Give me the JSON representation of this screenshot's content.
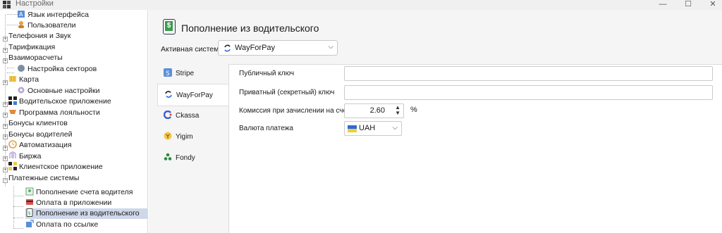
{
  "window": {
    "title": "Настройки"
  },
  "tree": {
    "items": [
      {
        "label": "Язык интерфейса"
      },
      {
        "label": "Пользователи"
      },
      {
        "label": "Телефония и Звук"
      },
      {
        "label": "Тарификация"
      },
      {
        "label": "Взаиморасчеты"
      },
      {
        "label": "Настройка секторов"
      },
      {
        "label": "Карта"
      },
      {
        "label": "Основные настройки"
      },
      {
        "label": "Водительское приложение"
      },
      {
        "label": "Программа лояльности"
      },
      {
        "label": "Бонусы клиентов"
      },
      {
        "label": "Бонусы водителей"
      },
      {
        "label": "Автоматизация"
      },
      {
        "label": "Биржа"
      },
      {
        "label": "Клиентское приложение"
      },
      {
        "label": "Платежные системы"
      },
      {
        "label": "Пополнение счета водителя"
      },
      {
        "label": "Оплата в приложении"
      },
      {
        "label": "Пополнение из водительского"
      },
      {
        "label": "Оплата по ссылке"
      }
    ]
  },
  "header": {
    "title": "Пополнение из водительского",
    "icon": "dollar-phone-icon",
    "icon_glyph": "$"
  },
  "active_system": {
    "label": "Активная система:",
    "value": "WayForPay"
  },
  "tabs": [
    {
      "label": "Stripe"
    },
    {
      "label": "WayForPay"
    },
    {
      "label": "Ckassa"
    },
    {
      "label": "Yigim"
    },
    {
      "label": "Fondy"
    }
  ],
  "form": {
    "public_key": {
      "label": "Публичный ключ",
      "value": ""
    },
    "private_key": {
      "label": "Приватный (секретный) ключ",
      "value": ""
    },
    "commission": {
      "label": "Комиссия при зачислении на счет",
      "value": "2.60",
      "unit": "%"
    },
    "currency": {
      "label": "Валюта платежа",
      "value": "UAH"
    }
  },
  "colors": {
    "selected_row": "#cfd8ea",
    "panel_bg": "#ffffff",
    "outer_bg": "#f5f5f5"
  }
}
